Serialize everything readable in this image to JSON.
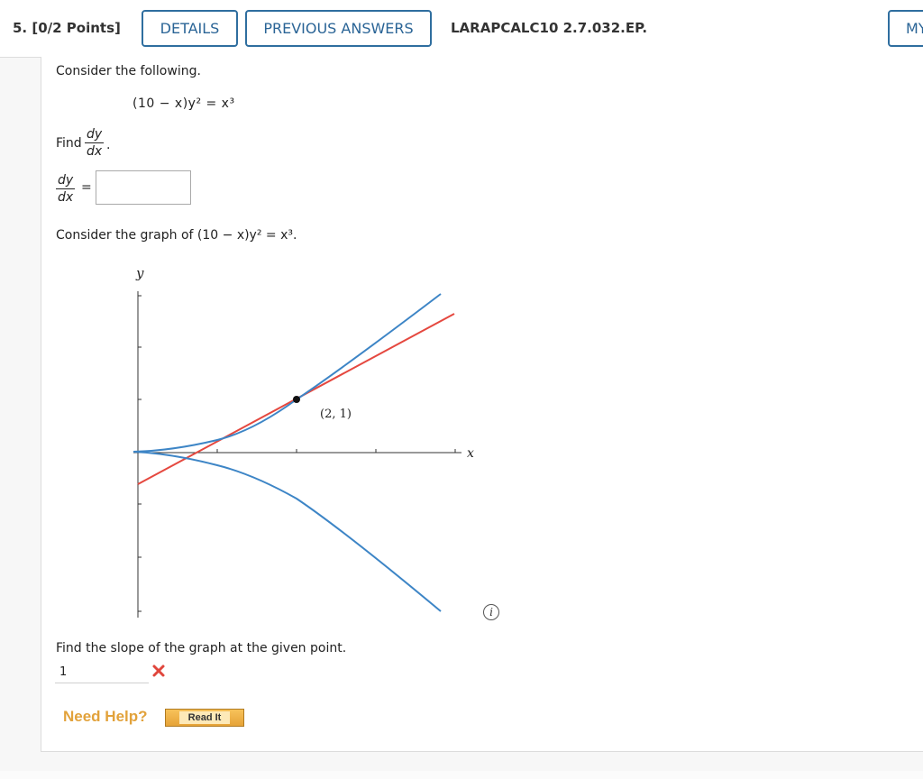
{
  "header": {
    "question_label": "5. [0/2 Points]",
    "details_label": "DETAILS",
    "previous_answers_label": "PREVIOUS ANSWERS",
    "problem_code": "LARAPCALC10 2.7.032.EP.",
    "my_notes_label": "MY"
  },
  "problem": {
    "intro": "Consider the following.",
    "equation": "(10 − x)y² = x³",
    "find_label": "Find",
    "dy": "dy",
    "dx": "dx",
    "period": ".",
    "equals": "=",
    "answer_value": "",
    "graph_intro": "Consider the graph of (10 − x)y² = x³.",
    "slope_prompt": "Find the slope of the graph at the given point.",
    "slope_value": "1",
    "slope_status": "incorrect"
  },
  "graph": {
    "y_axis_label": "y",
    "x_axis_label": "x",
    "point_label": "(2, 1)",
    "curve_color": "#3d85c6",
    "tangent_color": "#e5483f",
    "info_label": "i"
  },
  "help": {
    "need_help_label": "Need Help?",
    "read_it_label": "Read It"
  }
}
